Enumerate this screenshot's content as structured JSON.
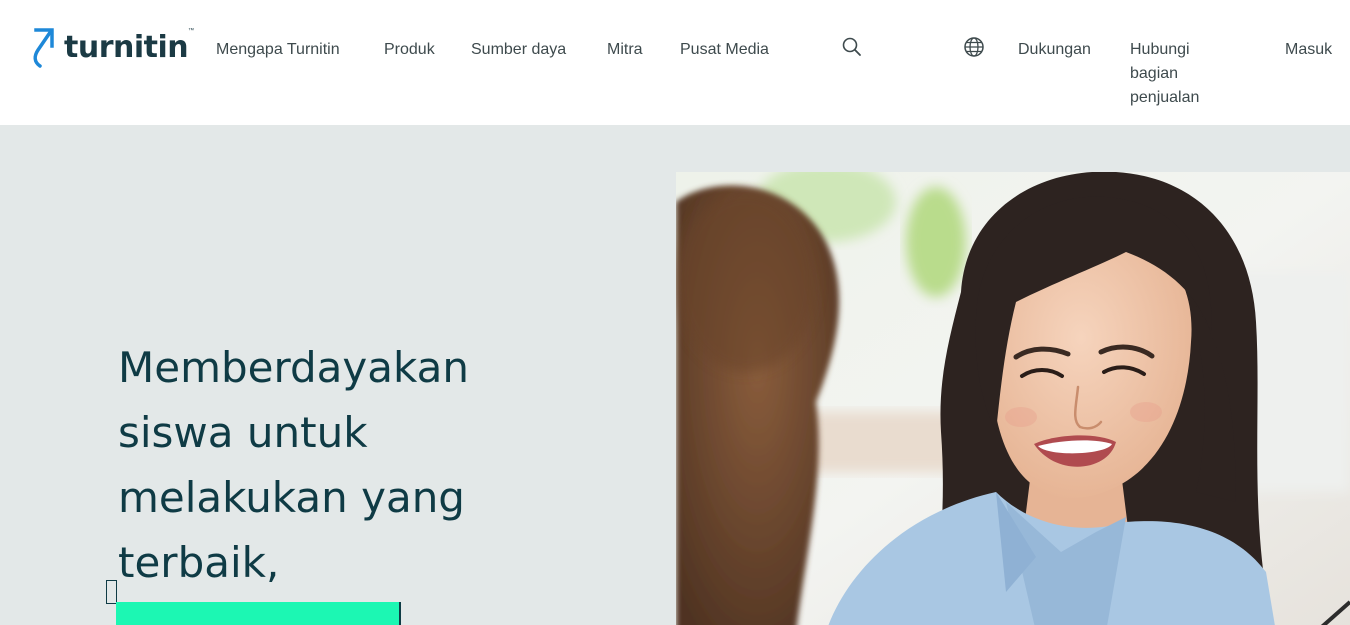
{
  "header": {
    "logo_text": "turnitin",
    "logo_tm": "™",
    "nav": [
      {
        "label": "Mengapa Turnitin"
      },
      {
        "label": "Produk"
      },
      {
        "label": "Sumber daya"
      },
      {
        "label": "Mitra"
      },
      {
        "label": "Pusat Media"
      }
    ],
    "search_icon": "search-icon",
    "globe_icon": "globe-icon",
    "support_label": "Dukungan",
    "sales_label": "Hubungi bagian penjualan",
    "login_label": "Masuk"
  },
  "hero": {
    "headline": "Memberdayakan siswa untuk melakukan yang terbaik,",
    "image_alt": "Smiling student in a light blue denim shirt talking with a classmate"
  },
  "colors": {
    "brand_dark": "#0f3b45",
    "brand_blue": "#1e88d8",
    "highlight_green": "#1cf7b3",
    "hero_bg": "#e3e8e8"
  }
}
